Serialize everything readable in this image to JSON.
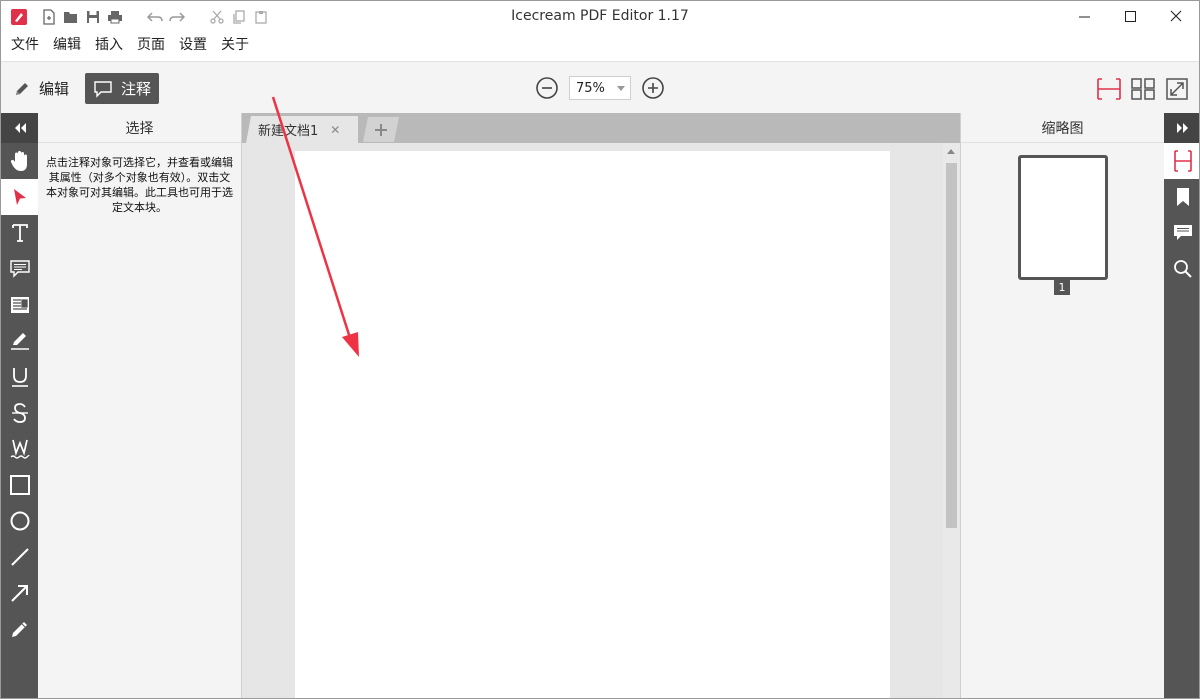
{
  "window": {
    "title": "Icecream PDF Editor 1.17"
  },
  "menu": [
    "文件",
    "编辑",
    "插入",
    "页面",
    "设置",
    "关于"
  ],
  "toolbar": {
    "edit_label": "编辑",
    "annotate_label": "注释",
    "zoom_value": "75%"
  },
  "left_panel": {
    "title": "选择",
    "description": "点击注释对象可选择它，并查看或编辑其属性（对多个对象也有效）。双击文本对象可对其编辑。此工具也可用于选定文本块。"
  },
  "document": {
    "tab_label": "新建文档1",
    "tab_close": "✕",
    "add_tab": "+"
  },
  "right_panel": {
    "title": "缩略图",
    "page_number": "1"
  },
  "colors": {
    "accent": "#e0304a",
    "rail": "#555555",
    "panel": "#f4f4f4"
  },
  "icons": {
    "left_rail": [
      "collapse-icon",
      "hand-icon",
      "select-arrow-icon",
      "text-icon",
      "comment-icon",
      "textbox-icon",
      "highlight-icon",
      "underline-icon",
      "strikethrough-icon",
      "squiggly-icon",
      "rectangle-icon",
      "ellipse-icon",
      "line-icon",
      "arrow-icon",
      "pencil-icon"
    ],
    "right_rail": [
      "expand-icon",
      "thumbnails-icon",
      "bookmark-icon",
      "comments-icon",
      "search-icon"
    ]
  }
}
